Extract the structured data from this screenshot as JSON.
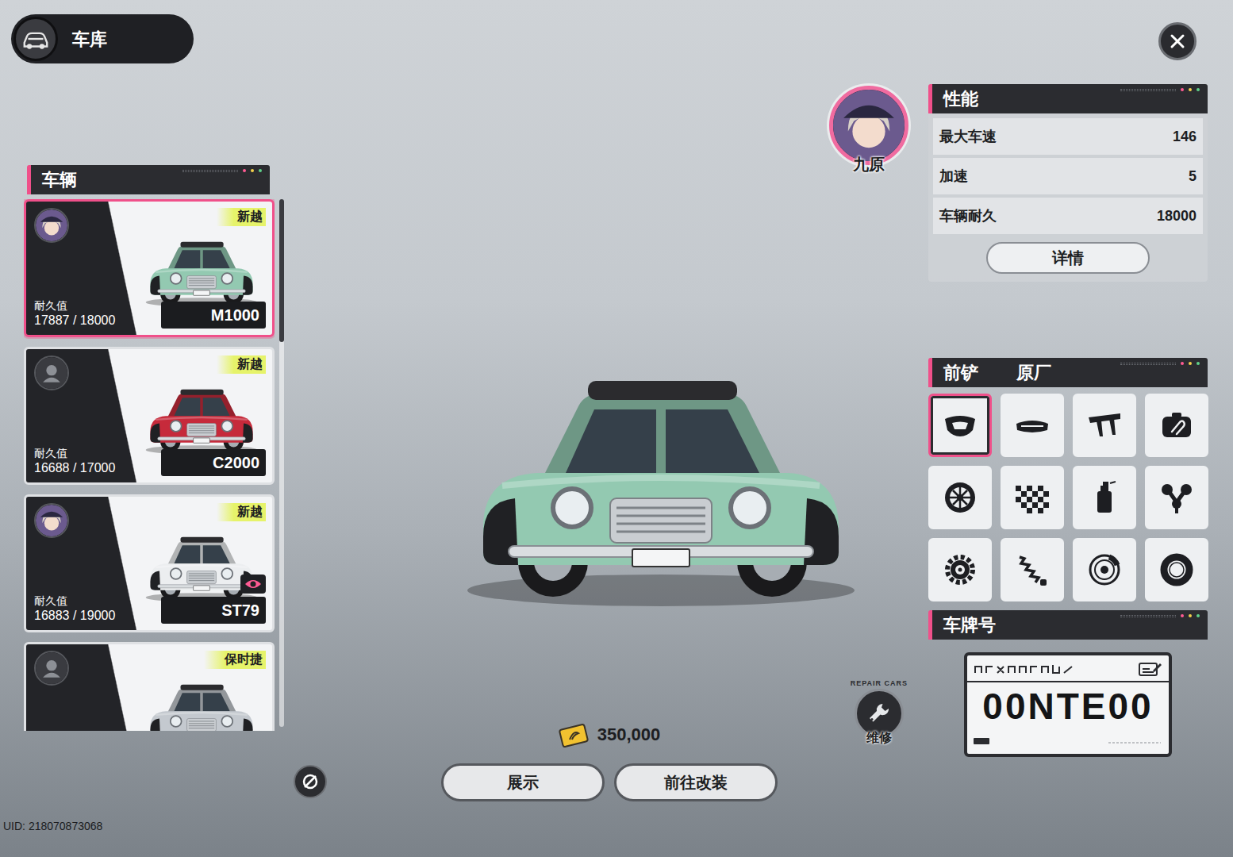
{
  "garage": {
    "title": "车库"
  },
  "vehicles_panel": {
    "title": "车辆",
    "scroll_level": 0.27
  },
  "vehicles": [
    {
      "brand": "新越",
      "durability_label": "耐久值",
      "durability": "17887 / 18000",
      "model": "M1000",
      "color": "#93c9b1",
      "selected": true,
      "has_driver": true,
      "on_display": false
    },
    {
      "brand": "新越",
      "durability_label": "耐久值",
      "durability": "16688 / 17000",
      "model": "C2000",
      "color": "#c62a3b",
      "selected": false,
      "has_driver": false,
      "on_display": false
    },
    {
      "brand": "新越",
      "durability_label": "耐久值",
      "durability": "16883 / 19000",
      "model": "ST79",
      "color": "#eceef0",
      "selected": false,
      "has_driver": true,
      "on_display": true
    },
    {
      "brand": "保时捷",
      "color": "#c4c9cf",
      "selected": false,
      "has_driver": false,
      "on_display": false
    }
  ],
  "driver": {
    "name": "九原"
  },
  "performance": {
    "title": "性能",
    "stats": [
      {
        "label": "最大车速",
        "value": "146"
      },
      {
        "label": "加速",
        "value": "5"
      },
      {
        "label": "车辆耐久",
        "value": "18000"
      }
    ],
    "details_button": "详情"
  },
  "parts": {
    "category": "前铲",
    "variant": "原厂",
    "slots": [
      {
        "selected": true
      },
      {
        "selected": false
      },
      {
        "selected": false
      },
      {
        "selected": false
      },
      {
        "selected": false
      },
      {
        "selected": false
      },
      {
        "selected": false
      },
      {
        "selected": false
      },
      {
        "selected": false
      },
      {
        "selected": false
      },
      {
        "selected": false
      },
      {
        "selected": false
      }
    ]
  },
  "plate": {
    "title": "车牌号",
    "number": "00NTE00"
  },
  "currency": {
    "amount": "350,000"
  },
  "repair": {
    "caption": "REPAIR CARS",
    "label": "维修"
  },
  "buttons": [
    {
      "label": "展示"
    },
    {
      "label": "前往改装"
    }
  ],
  "uid": "UID: 218070873068"
}
